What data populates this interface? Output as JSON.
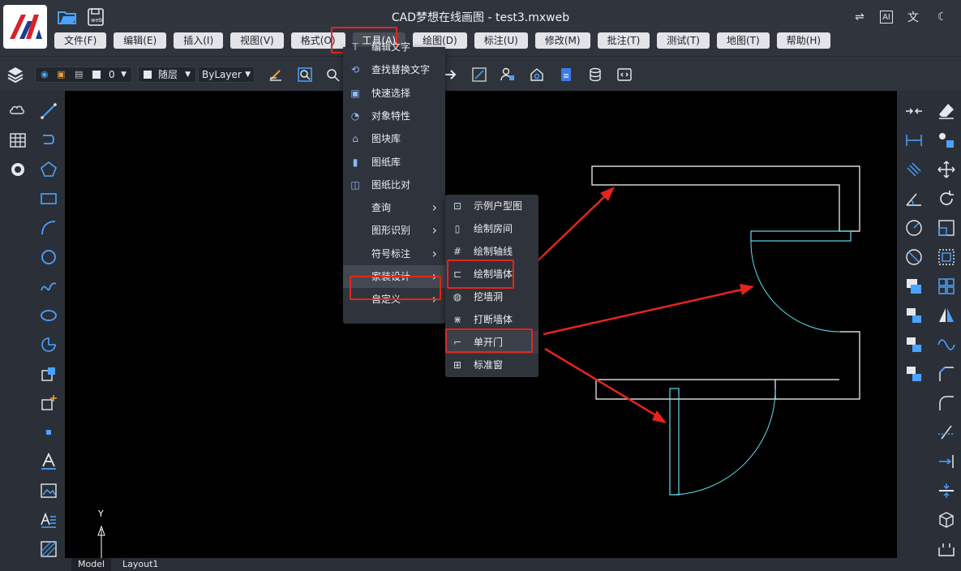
{
  "app": {
    "title": "CAD梦想在线画图 - test3.mxweb",
    "logo_name": "mxcad-logo",
    "file_icon_name": "open-folder-icon",
    "save_icon_name": "save-web-icon",
    "save_icon_text": "web"
  },
  "menubar": [
    {
      "key": "file",
      "label": "文件(F)"
    },
    {
      "key": "edit",
      "label": "编辑(E)"
    },
    {
      "key": "insert",
      "label": "插入(I)"
    },
    {
      "key": "view",
      "label": "视图(V)"
    },
    {
      "key": "format",
      "label": "格式(O)"
    },
    {
      "key": "tools",
      "label": "工具(A)",
      "active": true
    },
    {
      "key": "draw",
      "label": "绘图(D)"
    },
    {
      "key": "dimension",
      "label": "标注(U)"
    },
    {
      "key": "modify",
      "label": "修改(M)"
    },
    {
      "key": "annotate",
      "label": "批注(T)"
    },
    {
      "key": "test",
      "label": "测试(T)"
    },
    {
      "key": "map",
      "label": "地图(T)"
    },
    {
      "key": "help",
      "label": "帮助(H)"
    }
  ],
  "top_right_icons": [
    "swap-icon",
    "ai-icon",
    "translate-icon",
    "dark-mode-icon"
  ],
  "toolbar": {
    "layer_value": "0",
    "color_value": "随层",
    "linetype_value": "ByLayer"
  },
  "tools_menu": {
    "items": [
      {
        "label": "编辑文字",
        "icon": "edit-text-icon"
      },
      {
        "label": "查找替换文字",
        "icon": "find-replace-icon"
      },
      {
        "label": "快速选择",
        "icon": "quick-select-icon"
      },
      {
        "label": "对象特性",
        "icon": "object-properties-icon"
      },
      {
        "label": "图块库",
        "icon": "block-library-icon"
      },
      {
        "label": "图纸库",
        "icon": "drawing-library-icon"
      },
      {
        "label": "图纸比对",
        "icon": "drawing-compare-icon"
      },
      {
        "label": "查询",
        "submenu": true
      },
      {
        "label": "图形识别",
        "submenu": true
      },
      {
        "label": "符号标注",
        "submenu": true
      },
      {
        "label": "家装设计",
        "submenu": true,
        "highlighted": true
      },
      {
        "label": "自定义",
        "submenu": true
      }
    ]
  },
  "home_design_submenu": {
    "items": [
      {
        "label": "示例户型图",
        "icon": "sample-floorplan-icon"
      },
      {
        "label": "绘制房间",
        "icon": "draw-room-icon"
      },
      {
        "label": "绘制轴线",
        "icon": "draw-axis-icon"
      },
      {
        "label": "绘制墙体",
        "icon": "draw-wall-icon",
        "highlighted": true
      },
      {
        "label": "挖墙洞",
        "icon": "wall-hole-icon"
      },
      {
        "label": "打断墙体",
        "icon": "break-wall-icon"
      },
      {
        "label": "单开门",
        "icon": "single-door-icon",
        "highlighted": true,
        "prefix": "ƒ 、"
      },
      {
        "label": "标准窗",
        "icon": "standard-window-icon"
      }
    ]
  },
  "layout_tabs": [
    {
      "label": "Model",
      "active": true
    },
    {
      "label": "Layout1",
      "active": false
    }
  ],
  "ucs": {
    "y_label": "Y"
  },
  "colors": {
    "highlight_red": "#e5251c",
    "door_cyan": "#5fe0f0",
    "wall_white": "#ffffff",
    "canvas_bg": "#000000"
  }
}
